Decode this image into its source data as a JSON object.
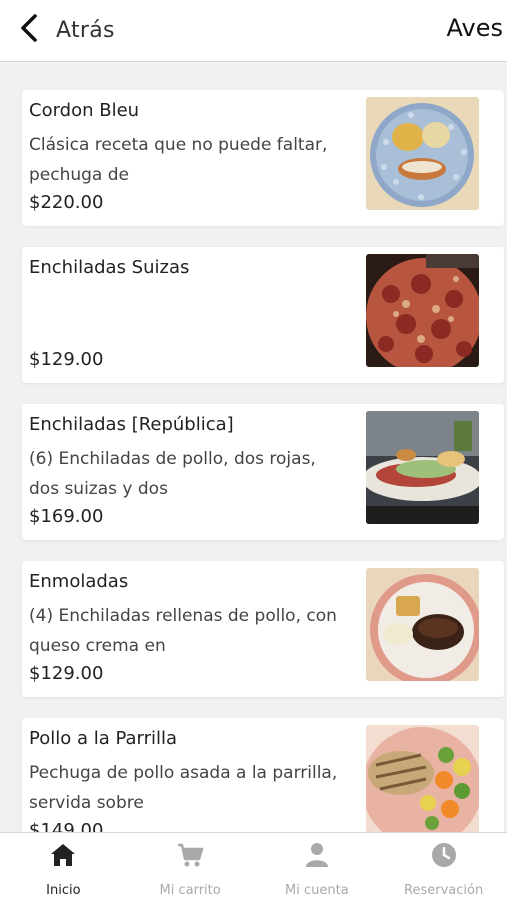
{
  "header": {
    "back_label": "Atrás",
    "title": "Aves"
  },
  "products": [
    {
      "name": "Cordon Bleu",
      "description": "Clásica receta que no puede faltar, pechuga de",
      "price": "$220.00",
      "image_icon": "cordon-bleu-photo"
    },
    {
      "name": "Enchiladas Suizas",
      "description": "",
      "price": "$129.00",
      "image_icon": "enchiladas-suizas-photo"
    },
    {
      "name": "Enchiladas [República]",
      "description": "(6) Enchiladas de pollo, dos rojas, dos suizas y dos",
      "price": "$169.00",
      "image_icon": "enchiladas-republica-photo"
    },
    {
      "name": "Enmoladas",
      "description": "(4) Enchiladas rellenas de pollo, con queso crema en",
      "price": "$129.00",
      "image_icon": "enmoladas-photo"
    },
    {
      "name": "Pollo a la Parrilla",
      "description": "Pechuga de pollo asada a la parrilla, servida sobre",
      "price": "$149.00",
      "image_icon": "pollo-parrilla-photo"
    }
  ],
  "tabbar": {
    "tabs": [
      {
        "label": "Inicio",
        "icon": "home-icon",
        "active": true
      },
      {
        "label": "Mi carrito",
        "icon": "cart-icon",
        "active": false
      },
      {
        "label": "Mi cuenta",
        "icon": "user-icon",
        "active": false
      },
      {
        "label": "Reservación",
        "icon": "clock-icon",
        "active": false
      }
    ]
  },
  "colors": {
    "background": "#f1f1f2",
    "card": "#ffffff",
    "active_tab": "#222222",
    "inactive_tab": "#a9a9a9"
  }
}
